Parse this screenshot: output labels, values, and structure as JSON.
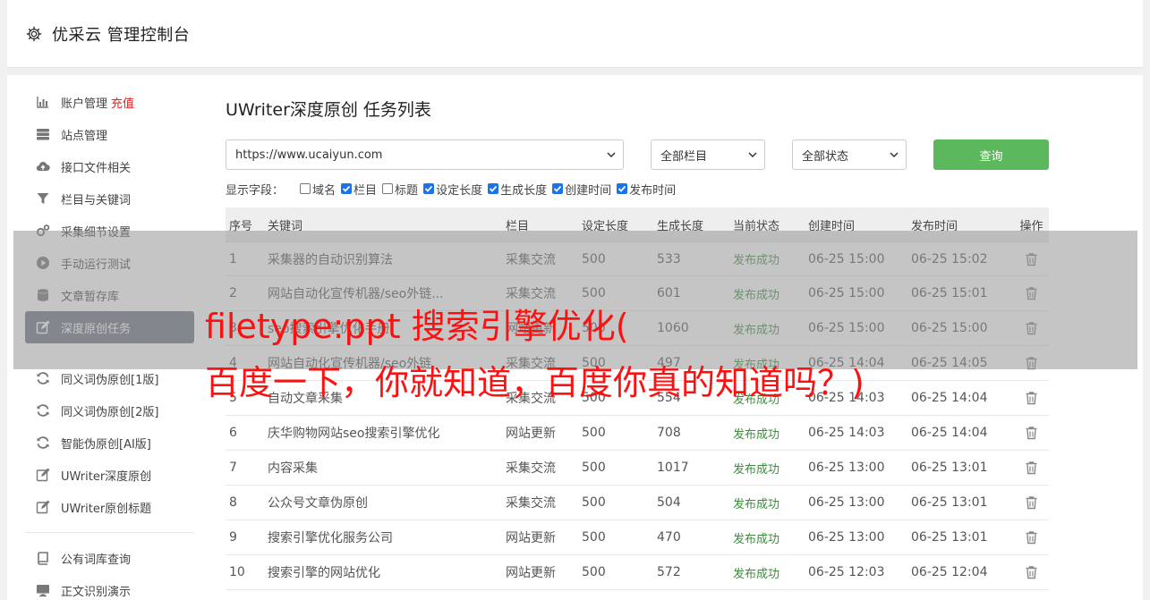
{
  "app": {
    "title": "优采云 管理控制台"
  },
  "sidebar": {
    "recharge_label": "充值",
    "group1": [
      {
        "label": "账户管理",
        "icon": "bar-chart-icon"
      },
      {
        "label": "站点管理",
        "icon": "server-icon"
      },
      {
        "label": "接口文件相关",
        "icon": "cloud-upload-icon"
      },
      {
        "label": "栏目与关键词",
        "icon": "filter-icon"
      },
      {
        "label": "采集细节设置",
        "icon": "gears-icon"
      },
      {
        "label": "手动运行测试",
        "icon": "play-icon"
      },
      {
        "label": "文章暂存库",
        "icon": "database-icon"
      },
      {
        "label": "深度原创任务",
        "icon": "edit-icon"
      }
    ],
    "group2": [
      {
        "label": "同义词伪原创[1版]",
        "icon": "refresh-icon"
      },
      {
        "label": "同义词伪原创[2版]",
        "icon": "refresh-icon"
      },
      {
        "label": "智能伪原创[AI版]",
        "icon": "refresh-icon"
      },
      {
        "label": "UWriter深度原创",
        "icon": "edit-icon"
      },
      {
        "label": "UWriter原创标题",
        "icon": "edit-icon"
      }
    ],
    "group3": [
      {
        "label": "公有词库查询",
        "icon": "book-icon"
      },
      {
        "label": "正文识别演示",
        "icon": "monitor-icon"
      }
    ]
  },
  "main": {
    "title": "UWriter深度原创 任务列表",
    "site_select": "https://www.ucaiyun.com",
    "column_select": "全部栏目",
    "status_select": "全部状态",
    "query_label": "查询",
    "fields_label": "显示字段：",
    "fields": [
      {
        "label": "域名",
        "checked": false
      },
      {
        "label": "栏目",
        "checked": true
      },
      {
        "label": "标题",
        "checked": false
      },
      {
        "label": "设定长度",
        "checked": true
      },
      {
        "label": "生成长度",
        "checked": true
      },
      {
        "label": "创建时间",
        "checked": true
      },
      {
        "label": "发布时间",
        "checked": true
      }
    ],
    "table": {
      "headers": [
        "序号",
        "关键词",
        "栏目",
        "设定长度",
        "生成长度",
        "当前状态",
        "创建时间",
        "发布时间",
        "操作"
      ],
      "rows": [
        [
          "1",
          "采集器的自动识别算法",
          "采集交流",
          "500",
          "533",
          "发布成功",
          "06-25 15:00",
          "06-25 15:02"
        ],
        [
          "2",
          "网站自动化宣传机器/seo外链...",
          "采集交流",
          "500",
          "601",
          "发布成功",
          "06-25 15:00",
          "06-25 15:01"
        ],
        [
          "3",
          "seo搜索引擎优化手册",
          "网站更新",
          "500",
          "1060",
          "发布成功",
          "06-25 15:00",
          "06-25 15:00"
        ],
        [
          "4",
          "网站自动化宣传机器/seo外链",
          "采集交流",
          "500",
          "497",
          "发布成功",
          "06-25 14:04",
          "06-25 14:05"
        ],
        [
          "5",
          "自动文章采集",
          "采集交流",
          "500",
          "554",
          "发布成功",
          "06-25 14:03",
          "06-25 14:04"
        ],
        [
          "6",
          "庆华购物网站seo搜索引擎优化",
          "网站更新",
          "500",
          "708",
          "发布成功",
          "06-25 14:03",
          "06-25 14:04"
        ],
        [
          "7",
          "内容采集",
          "采集交流",
          "500",
          "1017",
          "发布成功",
          "06-25 13:00",
          "06-25 13:01"
        ],
        [
          "8",
          "公众号文章伪原创",
          "采集交流",
          "500",
          "504",
          "发布成功",
          "06-25 13:00",
          "06-25 13:01"
        ],
        [
          "9",
          "搜索引擎优化服务公司",
          "网站更新",
          "500",
          "470",
          "发布成功",
          "06-25 13:00",
          "06-25 13:01"
        ],
        [
          "10",
          "搜索引擎的网站优化",
          "网站更新",
          "500",
          "572",
          "发布成功",
          "06-25 12:03",
          "06-25 12:04"
        ]
      ]
    }
  },
  "overlay": {
    "line1": "filetype:ppt 搜索引擎优化(",
    "line2": "百度一下，你就知道，百度你真的知道吗？)"
  },
  "colors": {
    "active_nav": "#6d7784",
    "query_button": "#5cb85c",
    "success": "#3c8c3c",
    "overlay_text": "#ff1010",
    "recharge": "#e02020"
  }
}
